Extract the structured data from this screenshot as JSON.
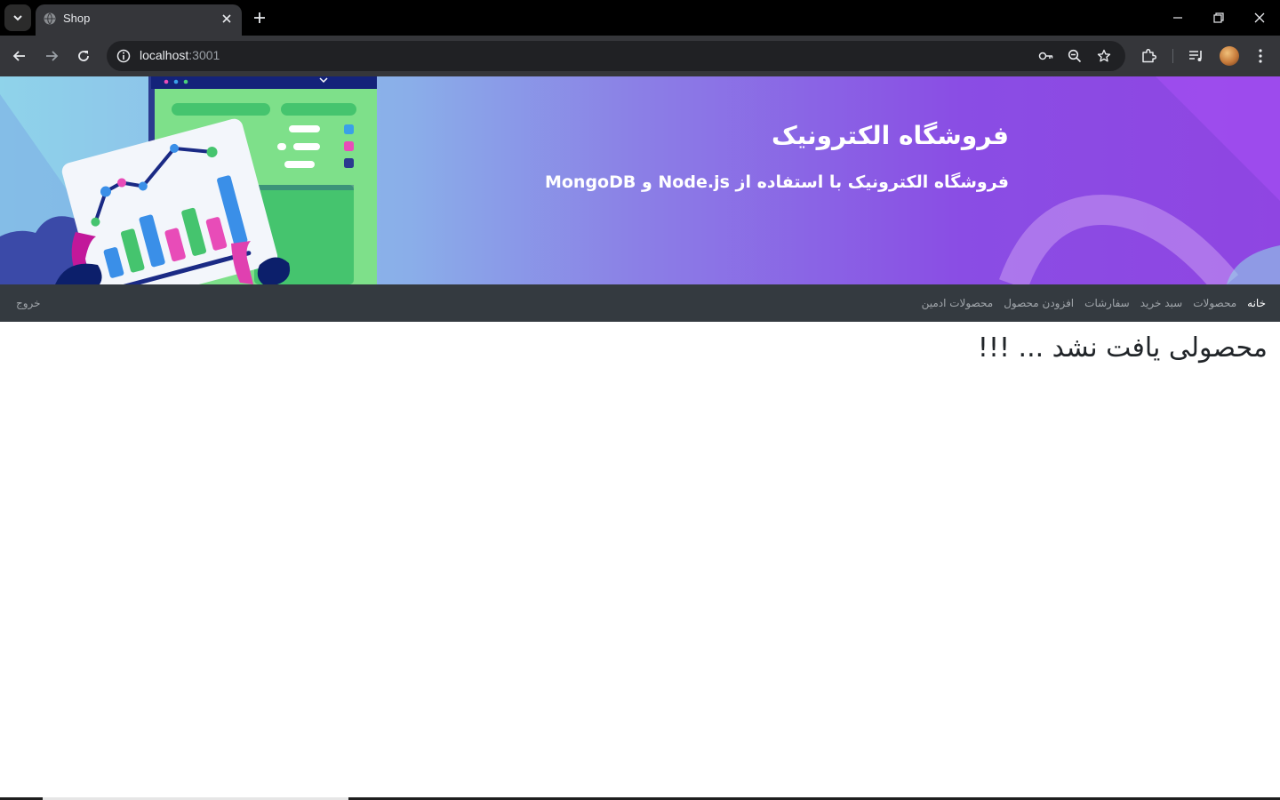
{
  "browser": {
    "tab_title": "Shop",
    "url_host": "localhost",
    "url_port": ":3001",
    "icons": [
      "tab-search-icon",
      "globe-icon",
      "close-icon",
      "plus-icon",
      "minimize-icon",
      "restore-icon",
      "window-close-icon",
      "back-arrow-icon",
      "forward-arrow-icon",
      "reload-icon",
      "site-info-icon",
      "key-icon",
      "zoom-out-icon",
      "star-icon",
      "extensions-icon",
      "media-icon",
      "profile-avatar",
      "more-vert-icon"
    ]
  },
  "hero": {
    "title": "فروشگاه الکترونیک",
    "subtitle": "فروشگاه الکترونیک با استفاده از Node.js و MongoDB",
    "colors": {
      "gradient_start": "#8fd3ea",
      "gradient_end": "#8f45e2"
    }
  },
  "navbar": {
    "items": [
      {
        "label": "خانه",
        "active": true
      },
      {
        "label": "محصولات",
        "active": false
      },
      {
        "label": "سبد خرید",
        "active": false
      },
      {
        "label": "سفارشات",
        "active": false
      },
      {
        "label": "افزودن محصول",
        "active": false
      },
      {
        "label": "محصولات ادمین",
        "active": false
      }
    ],
    "logout_label": "خروج",
    "colors": {
      "background": "#343a40",
      "link": "#a0a5aa",
      "active": "#ffffff"
    }
  },
  "main": {
    "empty_message": "محصولی یافت نشد ... !!!"
  }
}
